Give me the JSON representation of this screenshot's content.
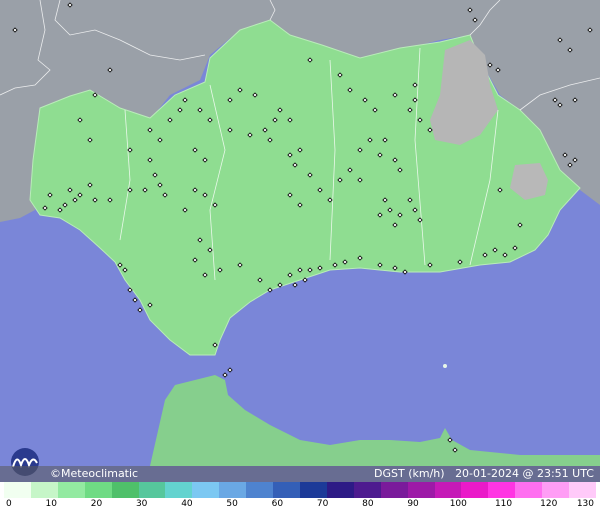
{
  "credit": "©Meteoclimatic",
  "product": "DGST (km/h)",
  "timestamp": "20-01-2024 @ 23:51 UTC",
  "legend": {
    "ticks": [
      "0",
      "10",
      "20",
      "30",
      "40",
      "50",
      "60",
      "70",
      "80",
      "90",
      "100",
      "110",
      "120",
      "130"
    ],
    "colors": [
      "#f1fff0",
      "#c6f6c8",
      "#93eaa1",
      "#6fdb84",
      "#4fc06a",
      "#56c79c",
      "#63d3cf",
      "#7cc8f2",
      "#6aa8e4",
      "#4e83cf",
      "#345fb7",
      "#1c3a98",
      "#2d1b86",
      "#4d1b8f",
      "#7a1b9b",
      "#9d1aa7",
      "#c51ab7",
      "#ea1ac9",
      "#ff35e3",
      "#ff6ff0",
      "#ff9df5",
      "#ffcaf9"
    ]
  },
  "colors": {
    "sea": "#7a86d8",
    "land_outside": "#9aa0a8",
    "region_green": "#8fdd91",
    "high_gray": "#b8b8b8",
    "station": "#000000"
  }
}
